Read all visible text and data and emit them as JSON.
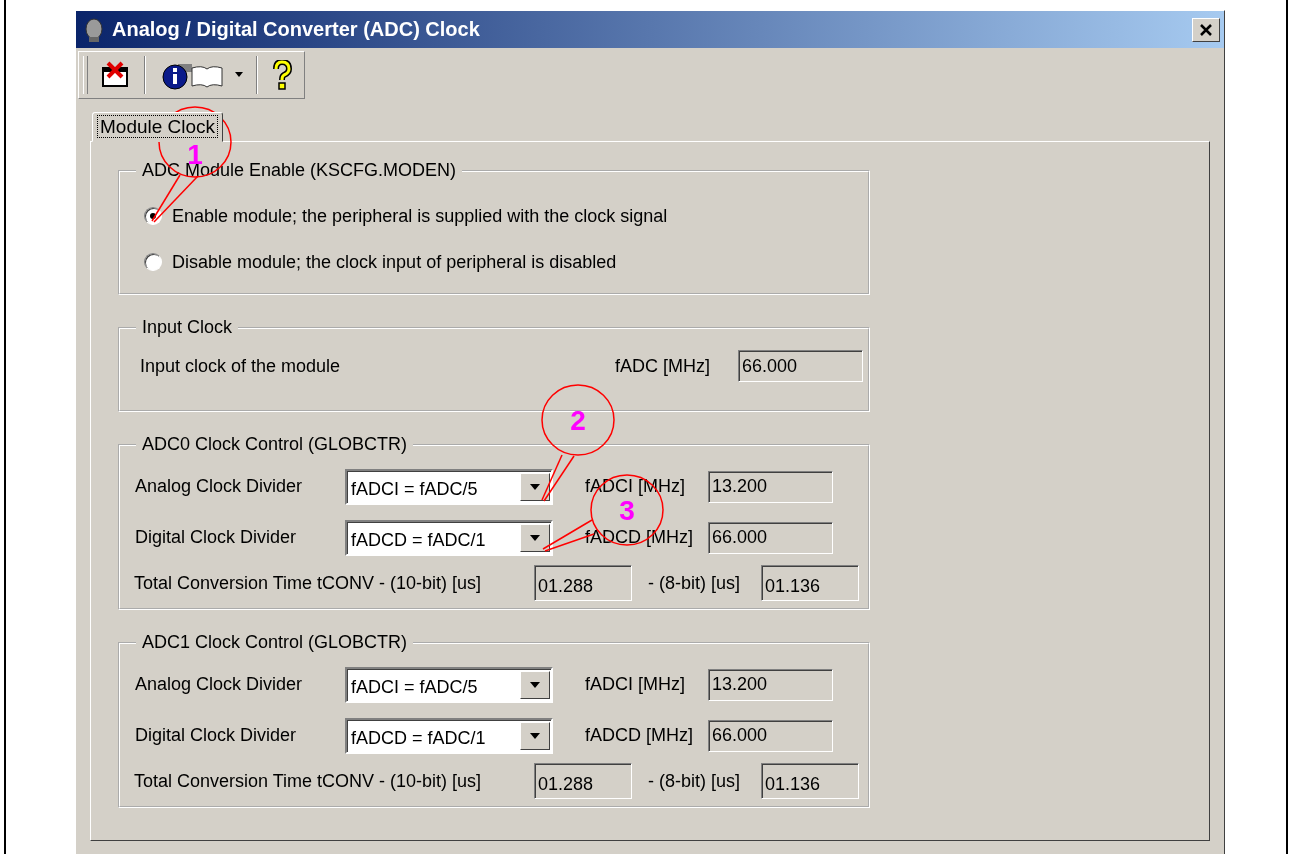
{
  "window": {
    "title": "Analog / Digital Converter (ADC) Clock"
  },
  "tabs": [
    {
      "label": "Module Clock",
      "selected": true
    }
  ],
  "groups": [
    {
      "kind": "radio",
      "title": "ADC Module Enable (KSCFG.MODEN)",
      "options": [
        {
          "label": "Enable module; the peripheral is supplied with the clock signal",
          "selected": true
        },
        {
          "label": "Disable module; the clock input of peripheral is disabled",
          "selected": false
        }
      ]
    },
    {
      "kind": "input",
      "title": "Input Clock",
      "label": "Input clock of the module",
      "field_label": "fADC [MHz]",
      "value": "66.000"
    },
    {
      "kind": "clock",
      "title": "ADC0 Clock Control (GLOBCTR)",
      "rows": [
        {
          "label": "Analog Clock Divider",
          "select": "fADCI = fADC/5",
          "field_label": "fADCI [MHz]",
          "value": "13.200"
        },
        {
          "label": "Digital Clock Divider",
          "select": "fADCD = fADC/1",
          "field_label": "fADCD [MHz]",
          "value": "66.000"
        }
      ],
      "conversion": {
        "label": "Total Conversion Time tCONV - (10-bit) [us]",
        "value": "01.288",
        "label_8bit": "- (8-bit) [us]",
        "value_8bit": "01.136"
      }
    },
    {
      "kind": "clock",
      "title": "ADC1 Clock Control (GLOBCTR)",
      "rows": [
        {
          "label": "Analog Clock Divider",
          "select": "fADCI = fADC/5",
          "field_label": "fADCI [MHz]",
          "value": "13.200"
        },
        {
          "label": "Digital Clock Divider",
          "select": "fADCD = fADC/1",
          "field_label": "fADCD [MHz]",
          "value": "66.000"
        }
      ],
      "conversion": {
        "label": "Total Conversion Time tCONV - (10-bit) [us]",
        "value": "01.288",
        "label_8bit": "- (8-bit) [us]",
        "value_8bit": "01.136"
      }
    }
  ],
  "callouts": [
    {
      "label": "1"
    },
    {
      "label": "2"
    },
    {
      "label": "3"
    }
  ]
}
